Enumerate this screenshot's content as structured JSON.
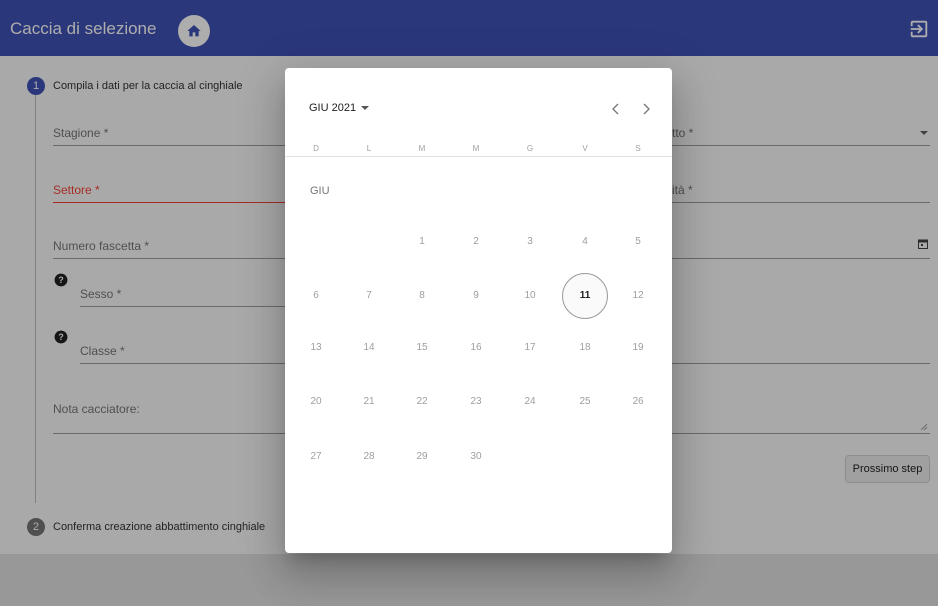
{
  "app": {
    "title": "Caccia di selezione"
  },
  "steps": [
    {
      "number": "1",
      "label": "Compila i dati per la caccia al cinghiale"
    },
    {
      "number": "2",
      "label": "Conferma creazione abbattimento cinghiale"
    }
  ],
  "form": {
    "stagione": "Stagione *",
    "settore": "Settore *",
    "numero_fascetta": "Numero fascetta *",
    "sesso": "Sesso *",
    "classe": "Classe *",
    "nota": "Nota cacciatore:",
    "right_field_1": "tto *",
    "right_field_2": "ità *",
    "next_button": "Prossimo step"
  },
  "date_picker": {
    "period": "GIU 2021",
    "prev_icon": "chevron-left-icon",
    "next_icon": "chevron-right-icon",
    "weekdays": [
      "D",
      "L",
      "M",
      "M",
      "G",
      "V",
      "S"
    ],
    "month_label": "GIU",
    "selected_day": "11",
    "weeks": [
      [
        "",
        "",
        "1",
        "2",
        "3",
        "4",
        "5"
      ],
      [
        "6",
        "7",
        "8",
        "9",
        "10",
        "11",
        "12"
      ],
      [
        "13",
        "14",
        "15",
        "16",
        "17",
        "18",
        "19"
      ],
      [
        "20",
        "21",
        "22",
        "23",
        "24",
        "25",
        "26"
      ],
      [
        "27",
        "28",
        "29",
        "30",
        "",
        "",
        ""
      ]
    ]
  },
  "colors": {
    "primary": "#3f51b5",
    "error": "#f44336"
  }
}
